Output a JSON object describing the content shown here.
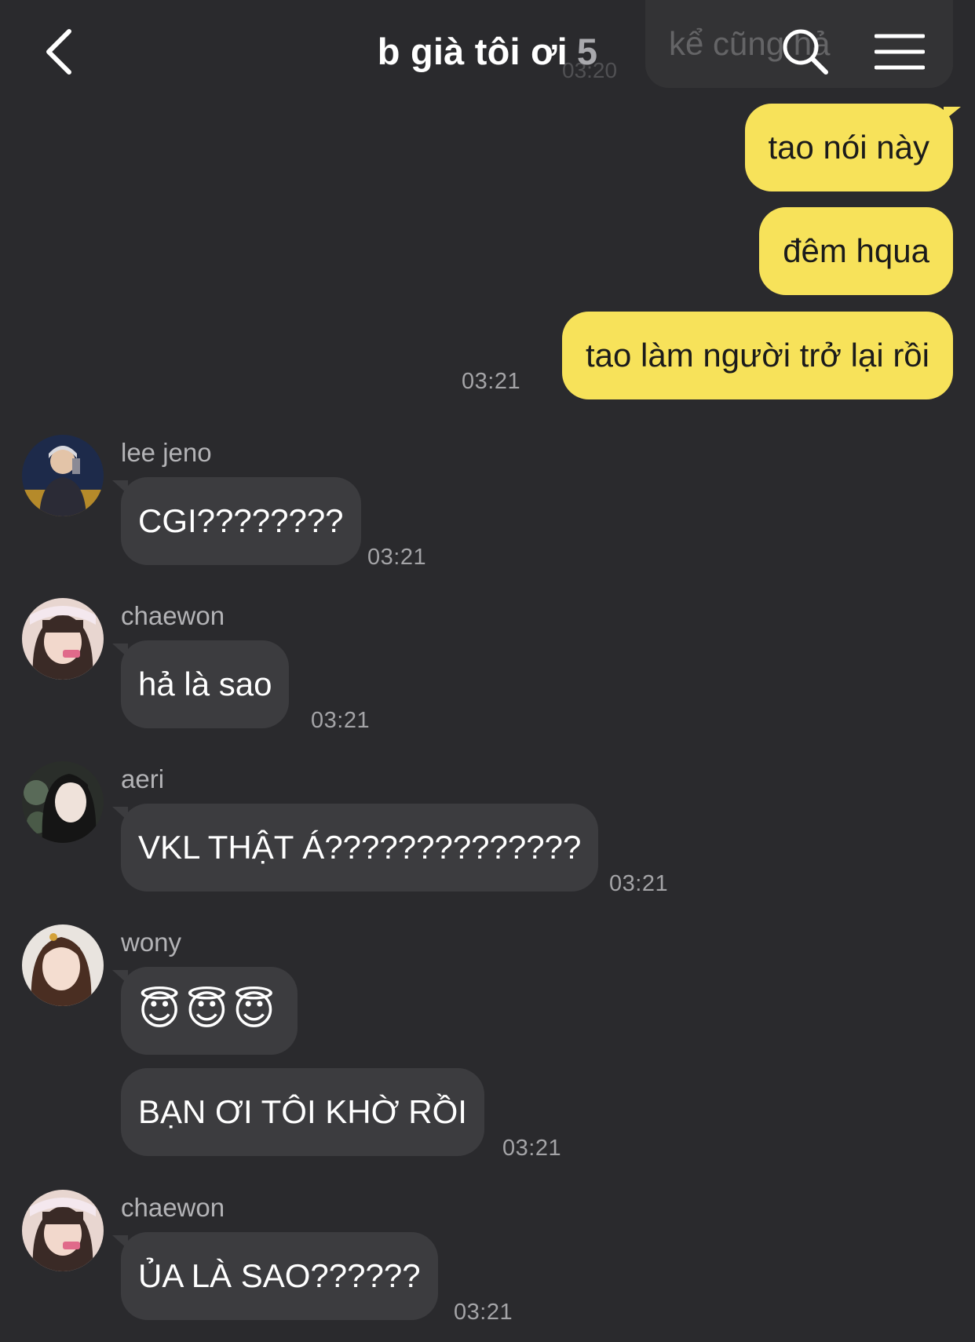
{
  "header": {
    "title": "b già tôi ơi",
    "member_count": "5"
  },
  "ghost": {
    "text": "kể cũng hả",
    "time": "03:20"
  },
  "my_messages": [
    {
      "text": "tao nói này"
    },
    {
      "text": "đêm hqua"
    },
    {
      "text": "tao làm người trở lại rồi",
      "time": "03:21"
    }
  ],
  "incoming": [
    {
      "sender": "lee jeno",
      "text": "CGI????????",
      "time": "03:21"
    },
    {
      "sender": "chaewon",
      "text": "hả là sao",
      "time": "03:21"
    },
    {
      "sender": "aeri",
      "text": "VKL THẬT Á??????????????",
      "time": "03:21"
    },
    {
      "sender": "wony",
      "text": "😇😇😇",
      "text2": "BẠN ƠI TÔI KHỜ RỒI",
      "time": "03:21"
    },
    {
      "sender": "chaewon",
      "text": "ỦA LÀ SAO??????",
      "time": "03:21"
    }
  ]
}
